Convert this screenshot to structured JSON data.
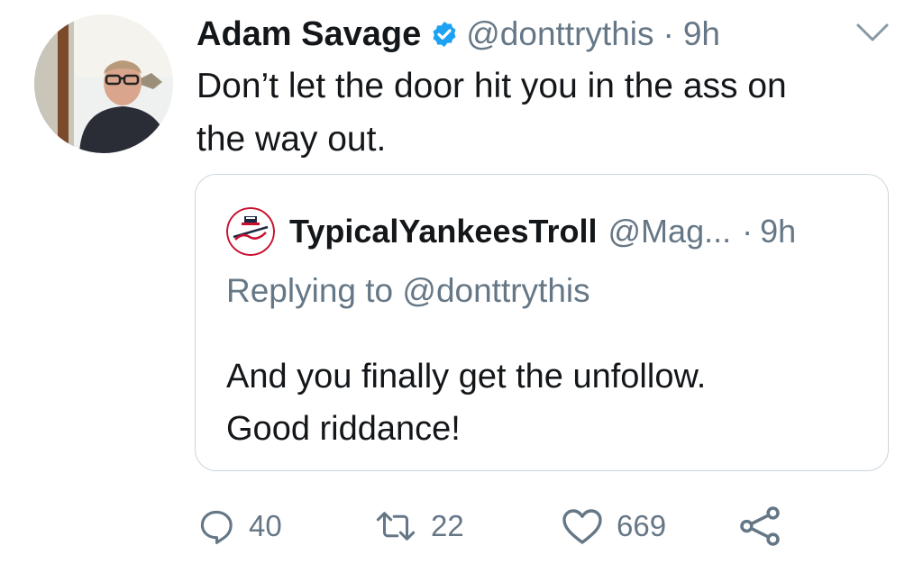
{
  "tweet": {
    "author_name": "Adam Savage",
    "author_handle": "@donttrythis",
    "separator": "·",
    "time": "9h",
    "text_line1": "Don’t let the door hit you in the ass on",
    "text_line2": "the way out.",
    "verified": true,
    "accent_color": "#1da1f2"
  },
  "quoted_tweet": {
    "author_name": "TypicalYankeesTroll",
    "author_handle": "@Mag...",
    "separator": "·",
    "time": "9h",
    "replying_to": "Replying to @donttrythis",
    "text_line1": "And you finally get the unfollow.",
    "text_line2": "Good riddance!"
  },
  "actions": {
    "reply_count": "40",
    "retweet_count": "22",
    "like_count": "669"
  },
  "icons": [
    "verified-badge-icon",
    "chevron-down-icon",
    "reply-icon",
    "retweet-icon",
    "like-icon",
    "share-icon"
  ]
}
